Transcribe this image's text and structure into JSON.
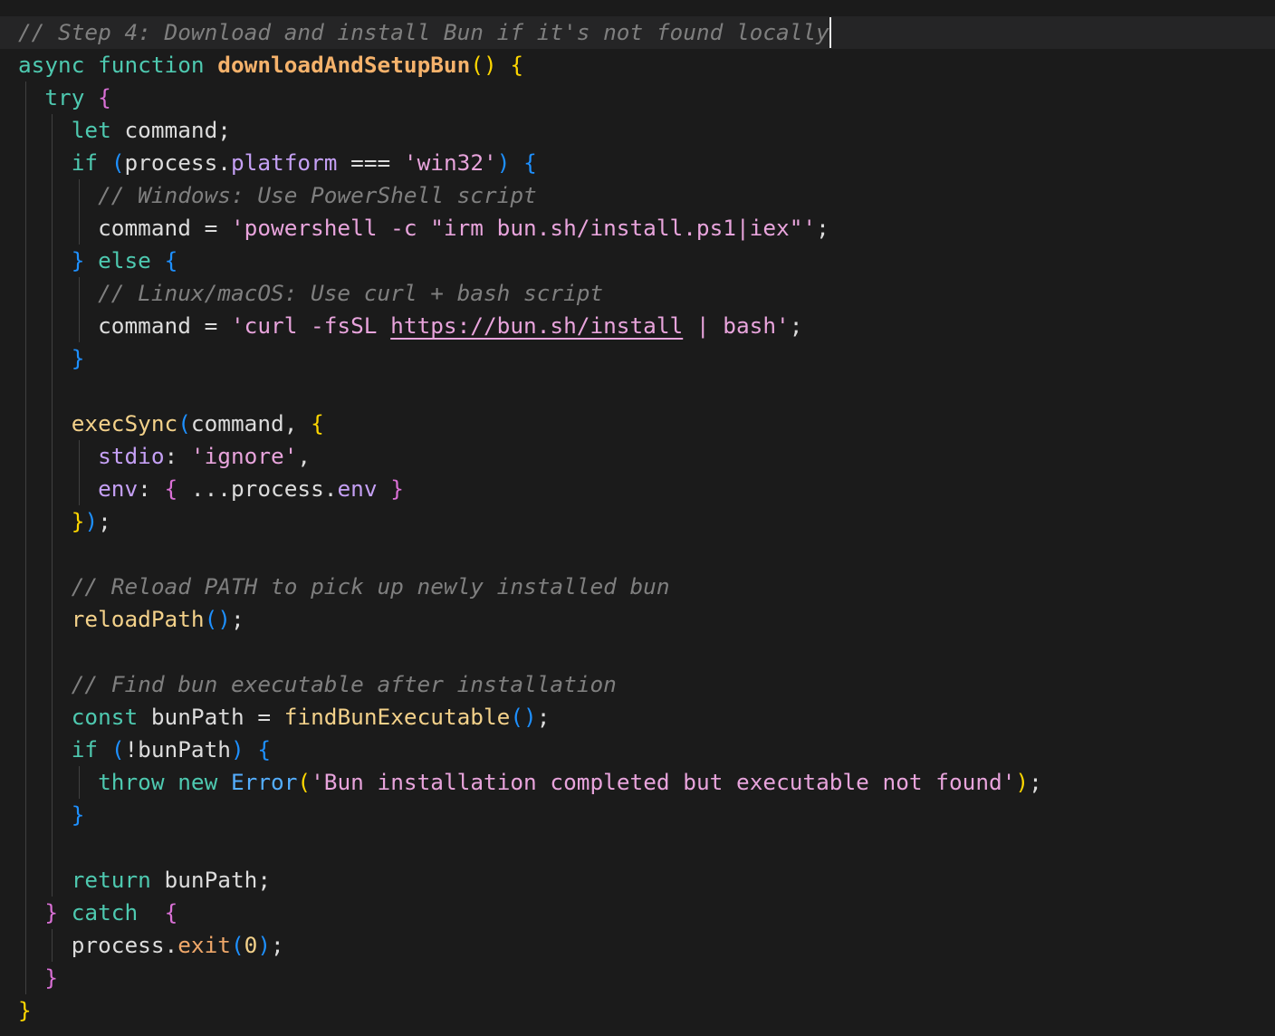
{
  "editor": {
    "language": "javascript",
    "colors": {
      "background": "#1b1b1b",
      "current_line": "#252526",
      "comment": "#7f7f7f",
      "keyword": "#4ec9b0",
      "function_name": "#f5b26b",
      "string": "#e8a4dc",
      "property": "#c5a0f5",
      "bracket_level_1": "#ffd700",
      "bracket_level_2": "#da70d6",
      "bracket_level_3": "#1e90ff"
    },
    "lines": [
      [
        [
          "comment",
          "// Step 4: Download and install Bun if it's not found locally"
        ],
        [
          "cursor",
          ""
        ]
      ],
      [
        [
          "keyword",
          "async"
        ],
        [
          "plain",
          " "
        ],
        [
          "keyword",
          "function"
        ],
        [
          "plain",
          " "
        ],
        [
          "func",
          "downloadAndSetupBun"
        ],
        [
          "b-yellow",
          "()"
        ],
        [
          "plain",
          " "
        ],
        [
          "b-yellow",
          "{"
        ]
      ],
      [
        [
          "plain",
          "  "
        ],
        [
          "keyword",
          "try"
        ],
        [
          "plain",
          " "
        ],
        [
          "b-pink",
          "{"
        ]
      ],
      [
        [
          "plain",
          "    "
        ],
        [
          "keyword",
          "let"
        ],
        [
          "plain",
          " command;"
        ]
      ],
      [
        [
          "plain",
          "    "
        ],
        [
          "keyword",
          "if"
        ],
        [
          "plain",
          " "
        ],
        [
          "b-blue",
          "("
        ],
        [
          "plain",
          "process."
        ],
        [
          "prop",
          "platform"
        ],
        [
          "plain",
          " === "
        ],
        [
          "string",
          "'win32'"
        ],
        [
          "b-blue",
          ")"
        ],
        [
          "plain",
          " "
        ],
        [
          "b-blue",
          "{"
        ]
      ],
      [
        [
          "plain",
          "      "
        ],
        [
          "comment",
          "// Windows: Use PowerShell script"
        ]
      ],
      [
        [
          "plain",
          "      command = "
        ],
        [
          "string",
          "'powershell -c \"irm bun.sh/install.ps1|iex\"'"
        ],
        [
          "plain",
          ";"
        ]
      ],
      [
        [
          "plain",
          "    "
        ],
        [
          "b-blue",
          "}"
        ],
        [
          "plain",
          " "
        ],
        [
          "keyword",
          "else"
        ],
        [
          "plain",
          " "
        ],
        [
          "b-blue",
          "{"
        ]
      ],
      [
        [
          "plain",
          "      "
        ],
        [
          "comment",
          "// Linux/macOS: Use curl + bash script"
        ]
      ],
      [
        [
          "plain",
          "      command = "
        ],
        [
          "string",
          "'curl -fsSL "
        ],
        [
          "url",
          "https://bun.sh/install"
        ],
        [
          "string",
          " | bash'"
        ],
        [
          "plain",
          ";"
        ]
      ],
      [
        [
          "plain",
          "    "
        ],
        [
          "b-blue",
          "}"
        ]
      ],
      [],
      [
        [
          "plain",
          "    "
        ],
        [
          "call",
          "execSync"
        ],
        [
          "b-blue",
          "("
        ],
        [
          "plain",
          "command, "
        ],
        [
          "b-yellow",
          "{"
        ]
      ],
      [
        [
          "plain",
          "      "
        ],
        [
          "prop",
          "stdio"
        ],
        [
          "plain",
          ": "
        ],
        [
          "string",
          "'ignore'"
        ],
        [
          "plain",
          ","
        ]
      ],
      [
        [
          "plain",
          "      "
        ],
        [
          "prop",
          "env"
        ],
        [
          "plain",
          ": "
        ],
        [
          "b-pink",
          "{"
        ],
        [
          "plain",
          " ...process."
        ],
        [
          "prop",
          "env"
        ],
        [
          "plain",
          " "
        ],
        [
          "b-pink",
          "}"
        ]
      ],
      [
        [
          "plain",
          "    "
        ],
        [
          "b-yellow",
          "}"
        ],
        [
          "b-blue",
          ")"
        ],
        [
          "plain",
          ";"
        ]
      ],
      [],
      [
        [
          "plain",
          "    "
        ],
        [
          "comment",
          "// Reload PATH to pick up newly installed bun"
        ]
      ],
      [
        [
          "plain",
          "    "
        ],
        [
          "call",
          "reloadPath"
        ],
        [
          "b-blue",
          "()"
        ],
        [
          "plain",
          ";"
        ]
      ],
      [],
      [
        [
          "plain",
          "    "
        ],
        [
          "comment",
          "// Find bun executable after installation"
        ]
      ],
      [
        [
          "plain",
          "    "
        ],
        [
          "keyword",
          "const"
        ],
        [
          "plain",
          " bunPath = "
        ],
        [
          "call",
          "findBunExecutable"
        ],
        [
          "b-blue",
          "()"
        ],
        [
          "plain",
          ";"
        ]
      ],
      [
        [
          "plain",
          "    "
        ],
        [
          "keyword",
          "if"
        ],
        [
          "plain",
          " "
        ],
        [
          "b-blue",
          "("
        ],
        [
          "plain",
          "!bunPath"
        ],
        [
          "b-blue",
          ")"
        ],
        [
          "plain",
          " "
        ],
        [
          "b-blue",
          "{"
        ]
      ],
      [
        [
          "plain",
          "      "
        ],
        [
          "keyword",
          "throw"
        ],
        [
          "plain",
          " "
        ],
        [
          "keyword",
          "new"
        ],
        [
          "plain",
          " "
        ],
        [
          "class",
          "Error"
        ],
        [
          "b-yellow",
          "("
        ],
        [
          "string",
          "'Bun installation completed but executable not found'"
        ],
        [
          "b-yellow",
          ")"
        ],
        [
          "plain",
          ";"
        ]
      ],
      [
        [
          "plain",
          "    "
        ],
        [
          "b-blue",
          "}"
        ]
      ],
      [],
      [
        [
          "plain",
          "    "
        ],
        [
          "keyword",
          "return"
        ],
        [
          "plain",
          " bunPath;"
        ]
      ],
      [
        [
          "plain",
          "  "
        ],
        [
          "b-pink",
          "}"
        ],
        [
          "plain",
          " "
        ],
        [
          "keyword",
          "catch"
        ],
        [
          "plain",
          "  "
        ],
        [
          "b-pink",
          "{"
        ]
      ],
      [
        [
          "plain",
          "    process."
        ],
        [
          "method",
          "exit"
        ],
        [
          "b-blue",
          "("
        ],
        [
          "number",
          "0"
        ],
        [
          "b-blue",
          ")"
        ],
        [
          "plain",
          ";"
        ]
      ],
      [
        [
          "plain",
          "  "
        ],
        [
          "b-pink",
          "}"
        ]
      ],
      [
        [
          "b-yellow",
          "}"
        ]
      ]
    ]
  }
}
